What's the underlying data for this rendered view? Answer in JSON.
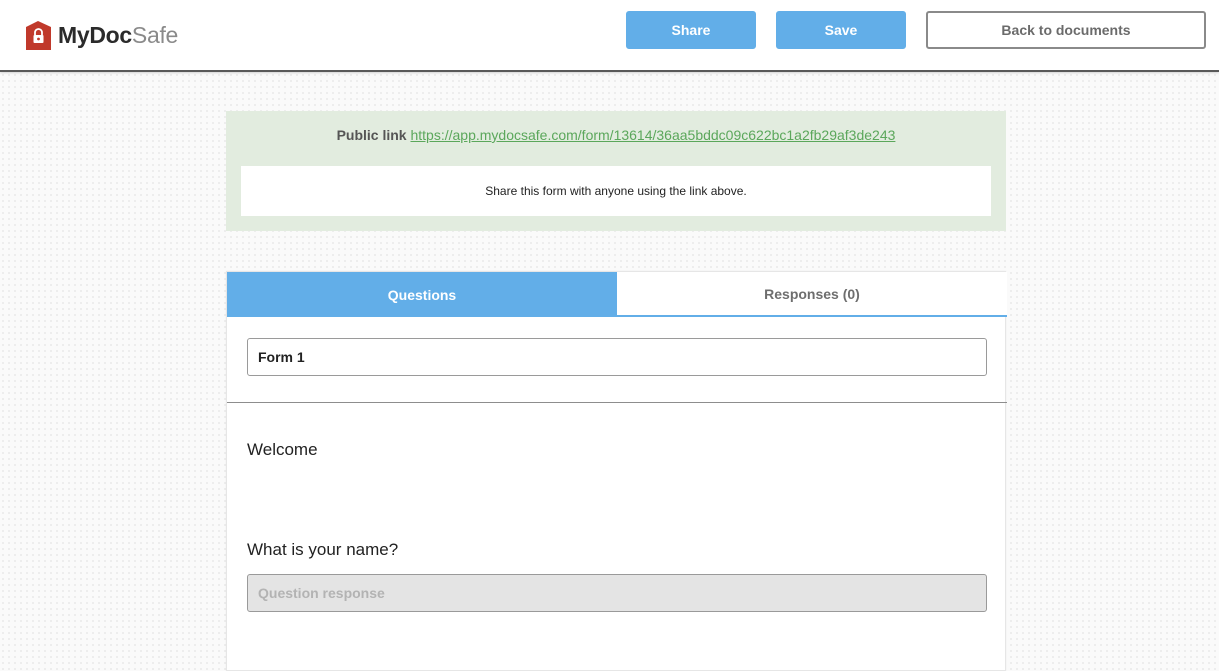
{
  "app": {
    "brand_strong": "MyDoc",
    "brand_light": "Safe"
  },
  "toolbar": {
    "share_label": "Share",
    "save_label": "Save",
    "back_label": "Back to documents"
  },
  "public_link": {
    "label": "Public link",
    "url": "https://app.mydocsafe.com/form/13614/36aa5bddc09c622bc1a2fb29af3de243",
    "note": "Share this form with anyone using the link above."
  },
  "tabs": [
    {
      "label": "Questions",
      "active": true
    },
    {
      "label": "Responses (0)",
      "active": false
    }
  ],
  "form": {
    "title_value": "Form 1",
    "section_text": "Welcome",
    "question": "What is your name?",
    "response_placeholder": "Question response"
  },
  "colors": {
    "accent": "#62aee8",
    "link_panel_bg": "#e2ecdf",
    "link_color": "#5ba75b",
    "logo_red": "#c0392b"
  },
  "icons": {
    "logo": "lock-house-icon"
  }
}
